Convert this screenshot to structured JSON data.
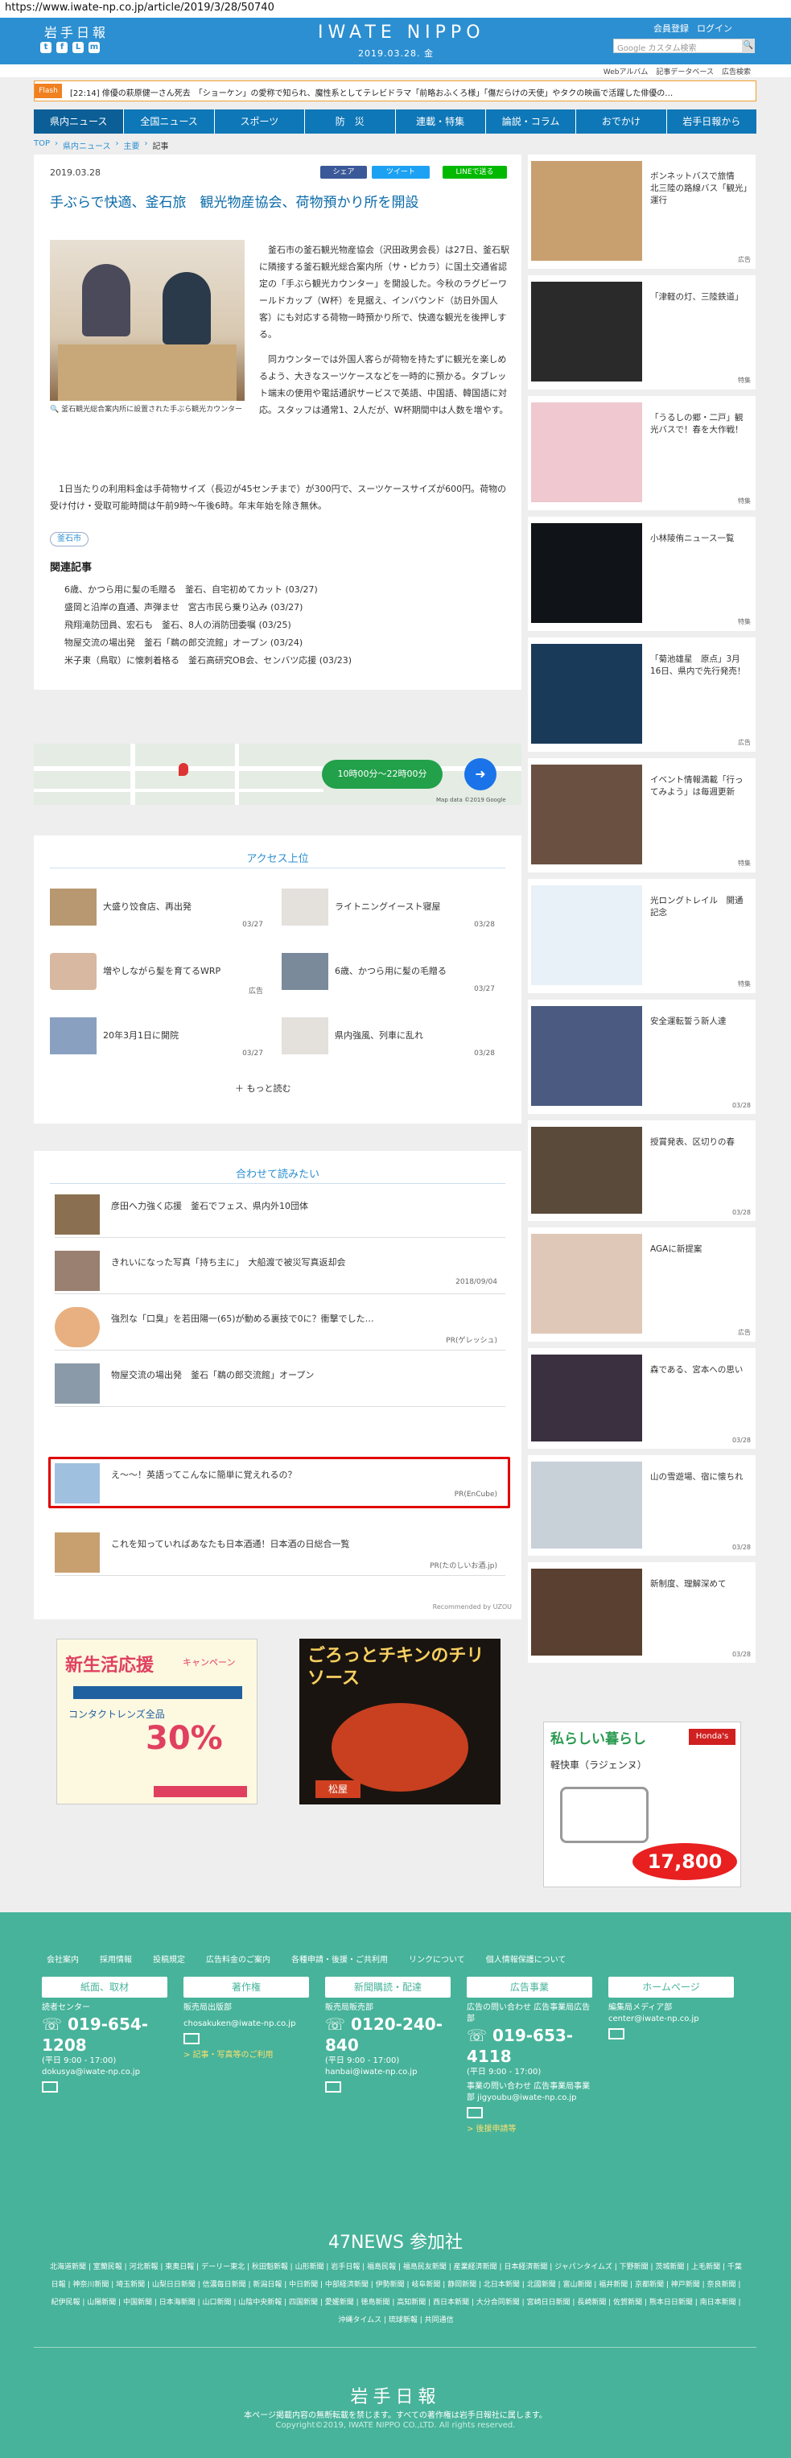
{
  "url": "https://www.iwate-np.co.jp/article/2019/3/28/50740",
  "header": {
    "logo_small": "岩手日報",
    "logo_main": "IWATE NIPPO",
    "date": "2019.03.28. 金",
    "links": [
      "会員登録",
      "ログイン"
    ],
    "search_placeholder": "Google カスタム検索",
    "sns": [
      "t",
      "f",
      "L",
      "m"
    ]
  },
  "subnav": [
    "Webアルバム",
    "記事データベース",
    "広告検索"
  ],
  "ticker": {
    "badge": "Flash",
    "text": "[22:14] 俳優の萩原健一さん死去　「ショーケン」の愛称で知られ、魔性系としてテレビドラマ「前略おふくろ様」「傷だらけの天使」やタクの映画で活躍した俳優の…"
  },
  "gnav": [
    "県内ニュース",
    "全国ニュース",
    "スポーツ",
    "防　災",
    "連載・特集",
    "論説・コラム",
    "おでかけ",
    "岩手日報から"
  ],
  "crumb": [
    "TOP",
    "県内ニュース",
    "主要",
    "記事"
  ],
  "article": {
    "date": "2019.03.28",
    "share": [
      "シェア",
      "ツイート",
      "LINEで送る"
    ],
    "title": "手ぶらで快適、釜石旅　観光物産協会、荷物預かり所を開設",
    "caption": "釜石観光総合案内所に設置された手ぶら観光カウンター",
    "body1": "　釜石市の釜石観光物産協会（沢田政男会長）は27日、釜石駅に隣接する釜石観光総合案内所（サ・ピカラ）に国土交通省認定の「手ぶら観光カウンター」を開設した。今秋のラグビーワールドカップ（W杯）を見据え、インバウンド（訪日外国人客）にも対応する荷物一時預かり所で、快適な観光を後押しする。",
    "body1b": "　同カウンターでは外国人客らが荷物を持たずに観光を楽しめるよう、大きなスーツケースなどを一時的に預かる。タブレット端末の使用や電話通訳サービスで英語、中国語、韓国語に対応。スタッフは通常1、2人だが、W杯期間中は人数を増やす。",
    "body2": "　1日当たりの利用料金は手荷物サイズ（長辺が45センチまで）が300円で、スーツケースサイズが600円。荷物の受け付け・受取可能時間は午前9時～午後6時。年末年始を除き無休。",
    "tag": "釜石市",
    "related_heading": "関連記事",
    "related": [
      "6歳、かつら用に髪の毛贈る　釜石、自宅初めてカット (03/27)",
      "盛岡と沿岸の直通、声弾ませ　宮古市民ら乗り込み (03/27)",
      "飛翔滝防団員、宏石も　釜石、8人の消防団委嘱 (03/25)",
      "物屋交流の場出発　釜石「鵜の郎交流館」オープン (03/24)",
      "米子東（鳥取）に懐刺着格る　釜石高研究OB会、センバツ応援 (03/23)"
    ]
  },
  "map": {
    "button": "10時00分～22時00分",
    "credit": "Map data ©2019 Google"
  },
  "access": {
    "title": "アクセス上位",
    "items": [
      {
        "title": "大盛り饺食店、再出発",
        "date": "03/27"
      },
      {
        "title": "ライトニングイースト寝屋",
        "date": "03/28"
      },
      {
        "title": "増やしながら髪を育てるWRP",
        "date": "広告"
      },
      {
        "title": "6歳、かつら用に髪の毛贈る",
        "date": "03/27"
      },
      {
        "title": "20年3月1日に開院",
        "date": "03/27"
      },
      {
        "title": "県内強風、列車に乱れ",
        "date": "03/28"
      }
    ],
    "more": "もっと読む"
  },
  "related2": {
    "title": "合わせて読みたい",
    "items": [
      {
        "title": "彦田へ力強く応援　釜石でフェス、県内外10団体",
        "meta": ""
      },
      {
        "title": "きれいになった写真「持ち主に」　大船渡で被災写真返却会",
        "meta": "2018/09/04"
      },
      {
        "title": "強烈な「口臭」を若田陽一(65)が動める裏技で0に？衝撃でした…",
        "meta": "PR(ゲレッシュ)"
      },
      {
        "title": "物屋交流の場出発　釜石「鵜の郎交流館」オープン",
        "meta": ""
      },
      {
        "title": "え～～！英語ってこんなに簡単に覚えれるの？",
        "meta": "PR(EnCube)"
      },
      {
        "title": "これを知っていればあなたも日本酒通！日本酒の日総合一覧",
        "meta": "PR(たのしいお酒.jp)"
      }
    ],
    "recby": "Recommended by UZOU"
  },
  "ads": {
    "ad1_title": "新生活応援",
    "ad1_sub": "キャンペーン",
    "ad1_pct": "30%",
    "ad1_small": "コンタクトレンズ全品",
    "ad2_title": "ごろっとチキンのチリソース",
    "ad2_brand": "松屋",
    "ad3_title": "私らしい暮らし",
    "ad3_prod": "軽快車（ラジェンヌ）",
    "ad3_price": "17,800",
    "ad3_brand": "Honda's"
  },
  "sidebar": [
    {
      "title": "ボンネットバスで旅情　北三陸の路線バス「観光」運行",
      "meta": "広告"
    },
    {
      "title": "「津軽の灯、三陸鉄道」",
      "meta": "特集"
    },
    {
      "title": "「うるしの郷・二戸」観光バスで！春を大作戦！",
      "meta": "特集"
    },
    {
      "title": "小林陵侑ニュース一覧",
      "meta": "特集"
    },
    {
      "title": "「菊池雄星　原点」3月16日、県内で先行発売！",
      "meta": "広告"
    },
    {
      "title": "イベント情報満載「行ってみよう」は毎週更新",
      "meta": "特集"
    },
    {
      "title": "光ロングトレイル　開通記念",
      "meta": "特集"
    },
    {
      "title": "安全運転誓う新人達",
      "meta": "03/28"
    },
    {
      "title": "授賞発表、区切りの春",
      "meta": "03/28"
    },
    {
      "title": "AGAに新提案",
      "meta": "広告"
    },
    {
      "title": "森である、宮本への思い",
      "meta": "03/28"
    },
    {
      "title": "山の雪遊場、宿に懐ちれ",
      "meta": "03/28"
    },
    {
      "title": "新制度、理解深めて",
      "meta": "03/28"
    }
  ],
  "footer": {
    "links": [
      "会社案内",
      "採用情報",
      "投稿規定",
      "広告料金のご案内",
      "各種申請・後援・ご共利用",
      "リンクについて",
      "個人情報保護について"
    ],
    "cols": [
      {
        "btn": "紙面、取材",
        "label": "読者センター",
        "phone": "019-654-1208",
        "hours": "(平日 9:00 - 17:00)",
        "mail": "dokusya@iwate-np.co.jp",
        "extra": ""
      },
      {
        "btn": "著作権",
        "label": "販売局出版部",
        "phone": "",
        "hours": "",
        "mail": "chosakuken@iwate-np.co.jp",
        "extra": "> 記事・写真等のご利用"
      },
      {
        "btn": "新聞購読・配達",
        "label": "販売局販売部",
        "phone": "0120-240-840",
        "hours": "(平日 9:00 - 17:00)",
        "mail": "hanbai@iwate-np.co.jp",
        "extra": ""
      },
      {
        "btn": "広告事業",
        "label": "広告の問い合わせ 広告事業局広告部",
        "phone": "019-653-4118",
        "hours": "(平日 9:00 - 17:00)",
        "mail": "事業の問い合わせ 広告事業局事業部 jigyoubu@iwate-np.co.jp",
        "extra": "> 後援申請等"
      },
      {
        "btn": "ホームページ",
        "label": "編集局メディア部",
        "phone": "",
        "hours": "",
        "mail": "center@iwate-np.co.jp",
        "extra": ""
      }
    ],
    "n47_title": "47NEWS 参加社",
    "n47_list": "北海道新聞 | 室蘭民報 | 河北新報 | 東奥日報 | デーリー東北 | 秋田魁新報 | 山形新聞 | 岩手日報 | 福島民報 | 福島民友新聞 | 産業経済新聞 | 日本経済新聞 | ジャパンタイムズ | 下野新聞 | 茨城新聞 | 上毛新聞 | 千葉日報 | 神奈川新聞 | 埼玉新聞 | 山梨日日新聞 | 信濃毎日新聞 | 新潟日報 | 中日新聞 | 中部経済新聞 | 伊勢新聞 | 岐阜新聞 | 静岡新聞 | 北日本新聞 | 北國新聞 | 富山新聞 | 福井新聞 | 京都新聞 | 神戸新聞 | 奈良新聞 | 紀伊民報 | 山陽新聞 | 中国新聞 | 日本海新聞 | 山口新聞 | 山陰中央新報 | 四国新聞 | 愛媛新聞 | 徳島新聞 | 高知新聞 | 西日本新聞 | 大分合同新聞 | 宮崎日日新聞 | 長崎新聞 | 佐賀新聞 | 熊本日日新聞 | 南日本新聞 | 沖縄タイムス | 琉球新報 | 共同通信",
    "logo": "岩手日報",
    "copy1": "本ページ掲載内容の無断転載を禁じます。すべての著作権は岩手日報社に属します。",
    "copy2": "Copyright©2019, IWATE NIPPO CO.,LTD. All rights reserved."
  }
}
